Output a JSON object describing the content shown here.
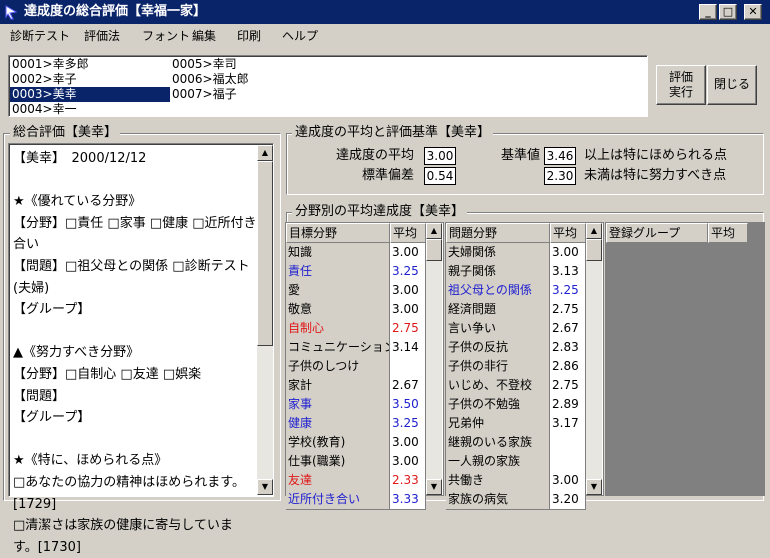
{
  "window": {
    "title": "達成度の総合評価【幸福一家】",
    "minimize_label": "_",
    "maximize_label": "□",
    "close_label": "✕"
  },
  "menu": [
    "診断テスト",
    "評価法",
    "フォント",
    "編集",
    "印刷",
    "ヘルプ"
  ],
  "members": {
    "col1": [
      "0001>幸多郎",
      "0002>幸子",
      "0003>美幸",
      "0004>幸一"
    ],
    "col2": [
      "0005>幸司",
      "0006>福太郎",
      "0007>福子"
    ],
    "selected": "0003>美幸"
  },
  "buttons": {
    "evaluate_line1": "評価",
    "evaluate_line2": "実行",
    "close": "閉じる"
  },
  "overall": {
    "title": "総合評価【美幸】",
    "text": "【美幸】　2000/12/12\n\n★《優れている分野》\n【分野】□責任 □家事 □健康 □近所付き合い\n【問題】□祖父母との関係 □診断テスト(夫婦)\n【グループ】\n\n▲《努力すべき分野》\n【分野】□自制心 □友達 □娯楽\n【問題】\n【グループ】\n\n★《特に、ほめられる点》\n□あなたの協力の精神はほめられます。[1729]\n□清潔さは家族の健康に寄与しています。[1730]"
  },
  "stats": {
    "title": "達成度の平均と評価基準【美幸】",
    "avg_label": "達成度の平均",
    "avg_value": "3.00",
    "sd_label": "標準偏差",
    "sd_value": "0.54",
    "criterion_label": "基準値",
    "upper_value": "3.46",
    "upper_note": "以上は特にほめられる点",
    "lower_value": "2.30",
    "lower_note": "未満は特に努力すべき点"
  },
  "field_avg": {
    "title": "分野別の平均達成度【美幸】",
    "goals_header": [
      "目標分野",
      "平均"
    ],
    "goals": [
      {
        "name": "知識",
        "value": "3.00",
        "color": "black"
      },
      {
        "name": "責任",
        "value": "3.25",
        "color": "blue"
      },
      {
        "name": "愛",
        "value": "3.00",
        "color": "black"
      },
      {
        "name": "敬意",
        "value": "3.00",
        "color": "black"
      },
      {
        "name": "自制心",
        "value": "2.75",
        "color": "red"
      },
      {
        "name": "コミュニケーション",
        "value": "3.14",
        "color": "black"
      },
      {
        "name": "子供のしつけ",
        "value": "",
        "color": "black"
      },
      {
        "name": "家計",
        "value": "2.67",
        "color": "black"
      },
      {
        "name": "家事",
        "value": "3.50",
        "color": "blue"
      },
      {
        "name": "健康",
        "value": "3.25",
        "color": "blue"
      },
      {
        "name": "学校(教育)",
        "value": "3.00",
        "color": "black"
      },
      {
        "name": "仕事(職業)",
        "value": "3.00",
        "color": "black"
      },
      {
        "name": "友達",
        "value": "2.33",
        "color": "red"
      },
      {
        "name": "近所付き合い",
        "value": "3.33",
        "color": "blue"
      }
    ],
    "problems_header": [
      "問題分野",
      "平均"
    ],
    "problems": [
      {
        "name": "夫婦関係",
        "value": "3.00",
        "color": "black"
      },
      {
        "name": "親子関係",
        "value": "3.13",
        "color": "black"
      },
      {
        "name": "祖父母との関係",
        "value": "3.25",
        "color": "blue"
      },
      {
        "name": "経済問題",
        "value": "2.75",
        "color": "black"
      },
      {
        "name": "言い争い",
        "value": "2.67",
        "color": "black"
      },
      {
        "name": "子供の反抗",
        "value": "2.83",
        "color": "black"
      },
      {
        "name": "子供の非行",
        "value": "2.86",
        "color": "black"
      },
      {
        "name": "いじめ、不登校",
        "value": "2.75",
        "color": "black"
      },
      {
        "name": "子供の不勉強",
        "value": "2.89",
        "color": "black"
      },
      {
        "name": "兄弟仲",
        "value": "3.17",
        "color": "black"
      },
      {
        "name": "継親のいる家族",
        "value": "",
        "color": "black"
      },
      {
        "name": "一人親の家族",
        "value": "",
        "color": "black"
      },
      {
        "name": "共働き",
        "value": "3.00",
        "color": "black"
      },
      {
        "name": "家族の病気",
        "value": "3.20",
        "color": "black"
      }
    ],
    "groups_header": [
      "登録グループ",
      "平均"
    ]
  },
  "colors": {
    "blue": "#2020d0",
    "red": "#e01818",
    "titlebar": "#0a246a"
  }
}
